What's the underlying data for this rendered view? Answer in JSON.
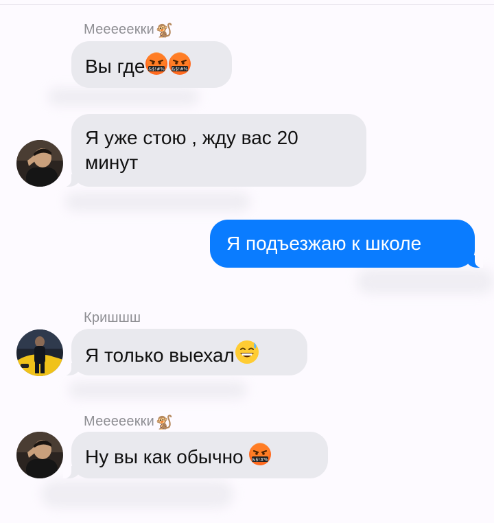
{
  "messages": [
    {
      "sender": "Мееееекки",
      "sender_icon": "monkey-icon",
      "text": "Вы где",
      "emojis": [
        "angry-symbols-emoji",
        "angry-symbols-emoji"
      ]
    },
    {
      "text_line1": "Я уже стою , жду вас 20",
      "text_line2": "минут",
      "avatar": "avatar-meeekki"
    },
    {
      "direction": "outgoing",
      "text": "Я подъезжаю к школе"
    },
    {
      "sender": "Кришшш",
      "text": "Я только выехал",
      "emojis": [
        "sweat-smile-emoji"
      ],
      "avatar": "avatar-krish"
    },
    {
      "sender": "Мееееекки",
      "sender_icon": "monkey-icon",
      "text": "Ну вы как обычно",
      "emojis": [
        "angry-symbols-emoji"
      ],
      "avatar": "avatar-meeekki"
    }
  ],
  "colors": {
    "background": "#fdfaff",
    "incoming_bubble": "#e9e9ee",
    "outgoing_bubble": "#0a7cff",
    "sender_name": "#8e8e93"
  }
}
